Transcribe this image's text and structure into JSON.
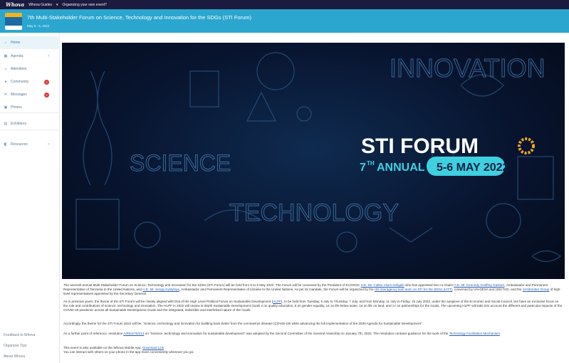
{
  "topbar": {
    "logo": "Whova",
    "menu_guides": "Whova Guides",
    "menu_organizing": "Organizing your own event?"
  },
  "header": {
    "title": "7th Multi-Stakeholder Forum on Science, Technology and Innovation for the SDGs (STI Forum)",
    "dates": "May 5 - 6, 2022"
  },
  "sidebar": {
    "items": [
      {
        "label": "Home",
        "icon": "home-icon"
      },
      {
        "label": "Agenda",
        "icon": "calendar-icon"
      },
      {
        "label": "Attendees",
        "icon": "people-icon"
      },
      {
        "label": "Community",
        "icon": "community-icon",
        "count": "3"
      },
      {
        "label": "Messages",
        "icon": "chat-icon",
        "count": "2"
      },
      {
        "label": "Photos",
        "icon": "photo-icon"
      },
      {
        "label": "Exhibitors",
        "icon": "building-icon"
      },
      {
        "label": "Resources",
        "icon": "folder-icon"
      }
    ],
    "footer": [
      "Feedback to Whova",
      "Organizer Tips",
      "About Whova"
    ]
  },
  "banner": {
    "word_innovation": "INNOVATION",
    "word_science": "SCIENCE",
    "word_technology": "TECHNOLOGY",
    "forum": "STI FORUM",
    "annual_num": "7",
    "annual_sup": "TH",
    "annual_word": "ANNUAL",
    "dates": "5-6 MAY 2022"
  },
  "text": {
    "p1_a": "The seventh annual Multi Stakeholder Forum on Science, Technology and Innovation for the SDGs (STI Forum) will be held from 5 to 6 May 2022. The Forum will be convened by the President of ECOSOC ",
    "p1_link1": "H.E. Mr. Collen Vixen Kelapile",
    "p1_b": " who has appointed two co-chairs ",
    "p1_link2": "H.E. Mr. Kennedy Godfrey Gastorn",
    "p1_c": ", Ambassador and Permanent Representative of Tanzania to the United Nations, and ",
    "p1_link3": "H.E. Mr. Sergiy Kyslytsya",
    "p1_d": ", Ambassador and Permanent Representative of Ukraine to the United Nations. As per its mandate, the Forum will be organized by the ",
    "p1_link4": "UN interagency task team on STI for the SDGs (IATT)",
    "p1_e": ", convened by UN-DESA and UNCTAD, and the ",
    "p1_link5": "10-Member Group",
    "p1_f": " of high-level representatives appointed by the Secretary General.",
    "p2_a": "As in previous years, the theme of the STI Forum will be closely aligned with that of the High Level Political Forum on Sustainable Development (",
    "p2_link1": "HLPF",
    "p2_b": "), to be held from Tuesday, 5 July to Thursday, 7 July, and from Monday, 11 July to Friday, 15 July 2022, under the auspices of the Economic and Social Council, but have an exclusive focus on the role and contributions of science, technology and innovation. The HLPF in 2022 will review in-depth Sustainable Development Goals 4 on quality education, 5 on gender equality, 14 on life below water, 15 on life on land, and 17 on partnerships for the Goals. The upcoming HLPF will take into account the different and particular impacts of the COVID-19 pandemic across all Sustainable Development Goals and the integrated, indivisible and interlinked nature of the Goals.",
    "p3": "Accordingly, the theme for the STI Forum 2022 will be: \"Science, technology and innovation for building back better from the coronavirus disease (COVID-19) while advancing the full implementation of the 2030 Agenda for Sustainable Development\".",
    "p4_a": "As a further point of reference, resolution ",
    "p4_link1": "A/RES/76/213",
    "p4_b": " on \"Science, technology and innovation for sustainable development\" was adopted by the Second Committee of the General Assembly on January 7th, 2022. The resolution contains guidance for the work of the ",
    "p4_link2": "Technology Facilitation Mechanism",
    "p4_c": ".",
    "p5_a": "This event is also available on the Whova Mobile App: ",
    "p5_link": "Download Link",
    "p5_b": "You can interact with others on your phone in the app more conveniently wherever you go."
  },
  "colors": {
    "topbar": "#1b1b3f",
    "header": "#2aa6cf",
    "badge_red": "#d9363e",
    "banner_accent": "#3fd0e0"
  }
}
